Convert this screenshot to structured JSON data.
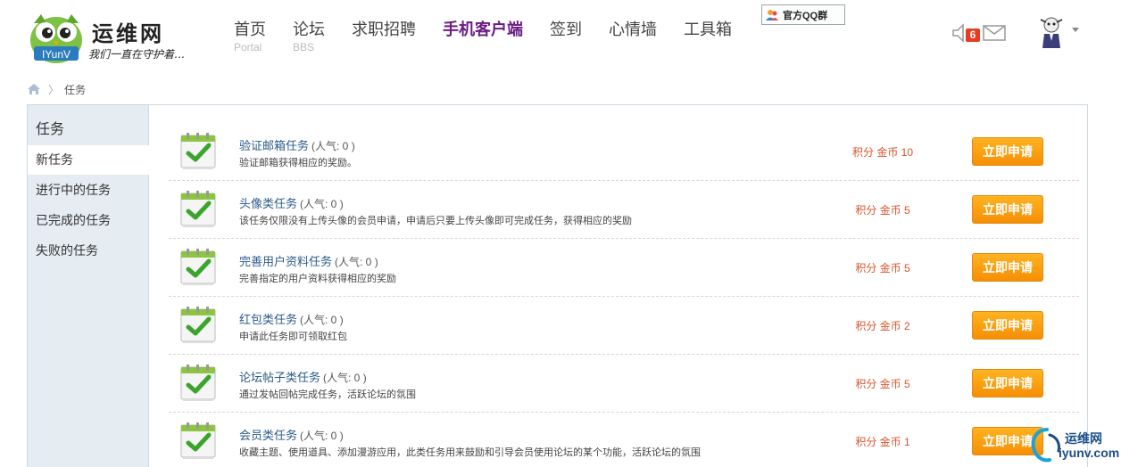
{
  "site": {
    "name": "运维网",
    "logo_text": "IYunV",
    "slogan": "我们一直在守护着…"
  },
  "nav": [
    {
      "label": "首页",
      "sub": "Portal",
      "active": false
    },
    {
      "label": "论坛",
      "sub": "BBS",
      "active": false
    },
    {
      "label": "求职招聘",
      "sub": "",
      "active": false
    },
    {
      "label": "手机客户端",
      "sub": "",
      "active": true
    },
    {
      "label": "签到",
      "sub": "",
      "active": false
    },
    {
      "label": "心情墙",
      "sub": "",
      "active": false
    },
    {
      "label": "工具箱",
      "sub": "",
      "active": false
    }
  ],
  "header": {
    "qq_group_label": "官方QQ群",
    "notice_count": "6"
  },
  "breadcrumb": {
    "current": "任务"
  },
  "sidebar": {
    "title": "任务",
    "items": [
      {
        "label": "新任务",
        "active": true
      },
      {
        "label": "进行中的任务",
        "active": false
      },
      {
        "label": "已完成的任务",
        "active": false
      },
      {
        "label": "失败的任务",
        "active": false
      }
    ]
  },
  "tasks": [
    {
      "name": "验证邮箱任务",
      "popularity": "(人气: 0 )",
      "desc": "验证邮箱获得相应的奖励。",
      "reward": "积分 金币 10",
      "button": "立即申请"
    },
    {
      "name": "头像类任务",
      "popularity": "(人气: 0 )",
      "desc": "该任务仅限没有上传头像的会员申请，申请后只要上传头像即可完成任务，获得相应的奖励",
      "reward": "积分 金币 5",
      "button": "立即申请"
    },
    {
      "name": "完善用户资料任务",
      "popularity": "(人气: 0 )",
      "desc": "完善指定的用户资料获得相应的奖励",
      "reward": "积分 金币 5",
      "button": "立即申请"
    },
    {
      "name": "红包类任务",
      "popularity": "(人气: 0 )",
      "desc": "申请此任务即可领取红包",
      "reward": "积分 金币 2",
      "button": "立即申请"
    },
    {
      "name": "论坛帖子类任务",
      "popularity": "(人气: 0 )",
      "desc": "通过发帖回帖完成任务，活跃论坛的氛围",
      "reward": "积分 金币 5",
      "button": "立即申请"
    },
    {
      "name": "会员类任务",
      "popularity": "(人气: 0 )",
      "desc": "收藏主题、使用道具、添加漫游应用，此类任务用来鼓励和引导会员使用论坛的某个功能，活跃论坛的氛围",
      "reward": "积分 金币 1",
      "button": "立即申请"
    }
  ],
  "watermark": {
    "title": "运维网",
    "url": "iyunv.com"
  },
  "colors": {
    "nav_active": "#6a1b84",
    "task_link": "#2a5a8a",
    "reward": "#d9542b",
    "button": "#f68f05",
    "sidebar_bg": "#e5edf2"
  }
}
